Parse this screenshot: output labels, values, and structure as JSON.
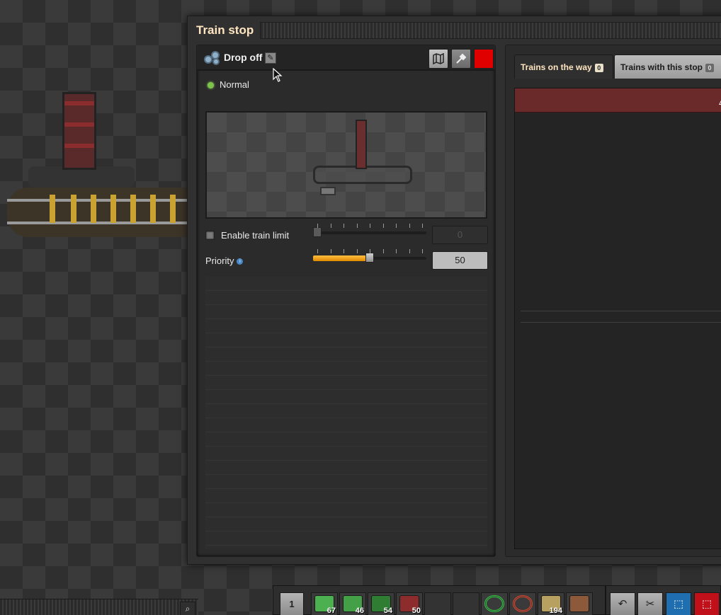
{
  "window": {
    "title": "Train stop"
  },
  "station": {
    "name": "Drop off",
    "status": "Normal",
    "color": "#e00000",
    "icons": {
      "map": "map-icon",
      "picker": "color-picker-icon",
      "rename": "pencil-icon"
    }
  },
  "controls": {
    "train_limit": {
      "label": "Enable train limit",
      "enabled": false,
      "value": "0"
    },
    "priority": {
      "label": "Priority",
      "value": "50",
      "slider_fraction": 0.5
    }
  },
  "tabs": [
    {
      "label": "Trains on the way",
      "count": "0"
    },
    {
      "label": "Trains with this stop",
      "count": "0"
    }
  ],
  "quickbar": {
    "page": "1",
    "slots": [
      {
        "name": "quickbar-slot-1",
        "icon": "inserter-icon",
        "count": "67",
        "color": "#4caf50"
      },
      {
        "name": "quickbar-slot-2",
        "icon": "inserter-icon",
        "count": "46",
        "color": "#43a047"
      },
      {
        "name": "quickbar-slot-3",
        "icon": "inserter-icon",
        "count": "54",
        "color": "#2e7d32"
      },
      {
        "name": "quickbar-slot-4",
        "icon": "train-stop-icon",
        "count": "50",
        "color": "#8c2c2c"
      },
      {
        "name": "quickbar-slot-5",
        "icon": "",
        "count": "",
        "color": ""
      },
      {
        "name": "quickbar-slot-6",
        "icon": "",
        "count": "",
        "color": ""
      },
      {
        "name": "quickbar-slot-7",
        "icon": "green-wire-icon",
        "count": "",
        "color": "#2ecc40"
      },
      {
        "name": "quickbar-slot-8",
        "icon": "red-wire-icon",
        "count": "",
        "color": "#e0452a"
      },
      {
        "name": "quickbar-slot-9",
        "icon": "rail-icon",
        "count": "194",
        "color": "#b8a060"
      },
      {
        "name": "quickbar-slot-10",
        "icon": "rail-signal-icon",
        "count": "",
        "color": "#8c5a3a"
      }
    ]
  },
  "toolbar": {
    "undo": "undo-icon",
    "cut": "scissors-icon",
    "select": "select-icon",
    "deconstruct": "deconstruct-icon"
  }
}
